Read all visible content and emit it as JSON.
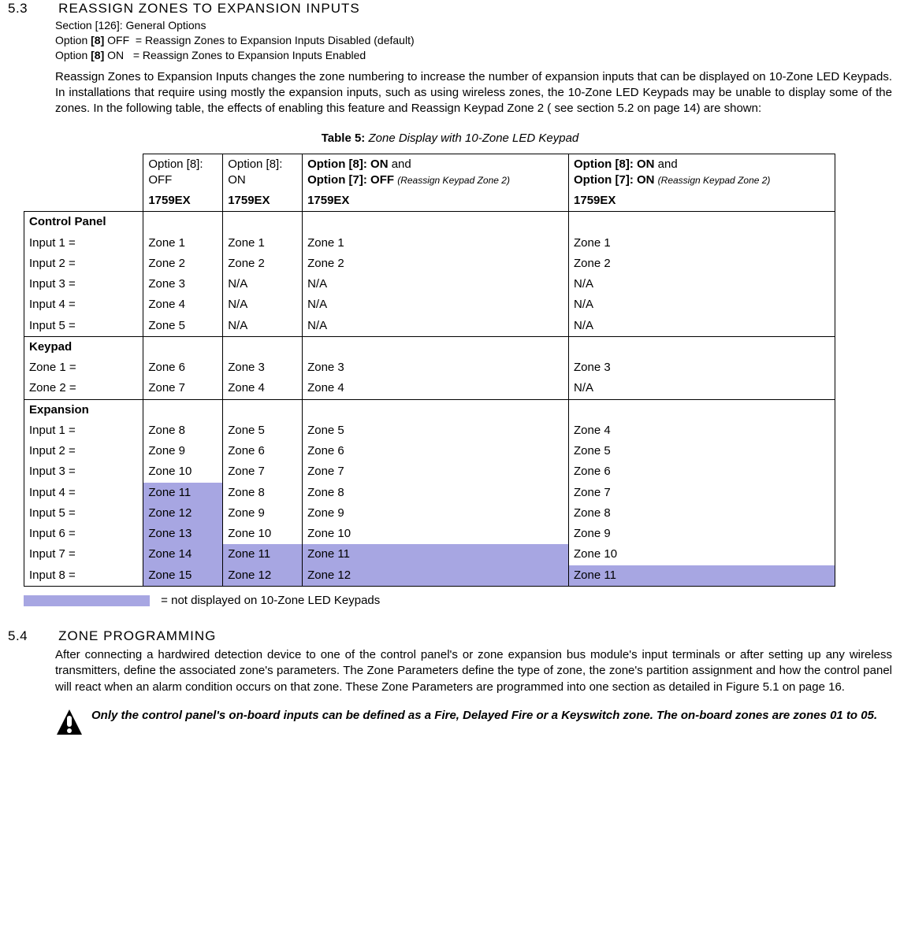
{
  "section53": {
    "num": "5.3",
    "title": "REASSIGN ZONES TO EXPANSION INPUTS",
    "subtitle": "Section [126]: General Options",
    "opt_line1_pre": "Option ",
    "opt_line1_bold": "[8]",
    "opt_line1_rest": " OFF  = Reassign Zones to Expansion Inputs Disabled (default)",
    "opt_line2_pre": "Option ",
    "opt_line2_bold": "[8]",
    "opt_line2_rest": " ON   = Reassign Zones to Expansion Inputs Enabled",
    "paragraph": "Reassign Zones to Expansion Inputs changes the zone numbering to increase the number of expansion inputs that can be displayed on 10-Zone LED Keypads. In installations that require using mostly the expansion inputs, such as using wireless zones, the 10-Zone LED Keypads may be unable to display some of the zones. In the following table, the effects of enabling this feature and Reassign Keypad Zone 2 ( see section 5.2 on page 14) are shown:"
  },
  "table": {
    "caption_bold": "Table 5: ",
    "caption_italic": "Zone Display with 10-Zone LED Keypad",
    "hdr": {
      "c1_l1": "Option [8]:",
      "c1_l2": "OFF",
      "c2_l1": "Option [8]:",
      "c2_l2": "ON",
      "c3_l1a": "Option [8]: ON",
      "c3_l1b": " and",
      "c3_l2a": "Option [7]: OFF ",
      "c3_l2b": "(Reassign Keypad Zone 2)",
      "c4_l1a": "Option [8]: ON",
      "c4_l1b": " and",
      "c4_l2a": "Option [7]: ON ",
      "c4_l2b": "(Reassign Keypad Zone 2)",
      "model": "1759EX"
    },
    "groups": [
      {
        "title": "Control Panel",
        "rows": [
          {
            "label": "Input 1 =",
            "c1": "Zone 1",
            "c2": "Zone 1",
            "c3": "Zone 1",
            "c4": "Zone 1"
          },
          {
            "label": "Input 2 =",
            "c1": "Zone 2",
            "c2": "Zone 2",
            "c3": "Zone 2",
            "c4": "Zone 2"
          },
          {
            "label": "Input 3 =",
            "c1": "Zone 3",
            "c2": "N/A",
            "c3": "N/A",
            "c4": "N/A"
          },
          {
            "label": "Input 4 =",
            "c1": "Zone 4",
            "c2": "N/A",
            "c3": "N/A",
            "c4": "N/A"
          },
          {
            "label": "Input 5 =",
            "c1": "Zone 5",
            "c2": "N/A",
            "c3": "N/A",
            "c4": "N/A"
          }
        ]
      },
      {
        "title": "Keypad",
        "rows": [
          {
            "label": "Zone 1 =",
            "c1": "Zone 6",
            "c2": "Zone 3",
            "c3": "Zone 3",
            "c4": "Zone 3"
          },
          {
            "label": "Zone 2 =",
            "c1": "Zone 7",
            "c2": "Zone 4",
            "c3": "Zone 4",
            "c4": "N/A"
          }
        ]
      },
      {
        "title": "Expansion",
        "rows": [
          {
            "label": "Input 1 =",
            "c1": "Zone 8",
            "c2": "Zone 5",
            "c3": "Zone 5",
            "c4": "Zone 4"
          },
          {
            "label": "Input 2 =",
            "c1": "Zone 9",
            "c2": "Zone 6",
            "c3": "Zone 6",
            "c4": "Zone 5"
          },
          {
            "label": "Input 3 =",
            "c1": "Zone 10",
            "c2": "Zone 7",
            "c3": "Zone 7",
            "c4": "Zone 6"
          },
          {
            "label": "Input 4 =",
            "c1": "Zone 11",
            "c1hl": true,
            "c2": "Zone 8",
            "c3": "Zone 8",
            "c4": "Zone 7"
          },
          {
            "label": "Input 5 =",
            "c1": "Zone 12",
            "c1hl": true,
            "c2": "Zone 9",
            "c3": "Zone 9",
            "c4": "Zone 8"
          },
          {
            "label": "Input 6 =",
            "c1": "Zone 13",
            "c1hl": true,
            "c2": "Zone 10",
            "c3": "Zone 10",
            "c4": "Zone 9"
          },
          {
            "label": "Input 7 =",
            "c1": "Zone 14",
            "c1hl": true,
            "c2": "Zone 11",
            "c2hl": true,
            "c3": "Zone 11",
            "c3hl": true,
            "c4": "Zone 10"
          },
          {
            "label": "Input 8 =",
            "c1": "Zone 15",
            "c1hl": true,
            "c2": "Zone 12",
            "c2hl": true,
            "c3": "Zone 12",
            "c3hl": true,
            "c4": "Zone 11",
            "c4hl": true
          }
        ]
      }
    ],
    "legend": "= not displayed on 10-Zone LED Keypads"
  },
  "section54": {
    "num": "5.4",
    "title": "ZONE PROGRAMMING",
    "paragraph": "After connecting a hardwired detection device to one of the control panel's or zone expansion bus module's input terminals or after setting up any wireless transmitters, define the associated zone's parameters. The Zone Parameters define the type of zone, the zone's partition assignment and how the control panel will react when an alarm condition occurs on that zone. These Zone Parameters are programmed into one section as detailed in Figure 5.1 on page 16.",
    "note": "Only the control panel's on-board inputs can be defined as a Fire, Delayed Fire or a Keyswitch zone. The on-board zones are zones 01 to 05."
  }
}
